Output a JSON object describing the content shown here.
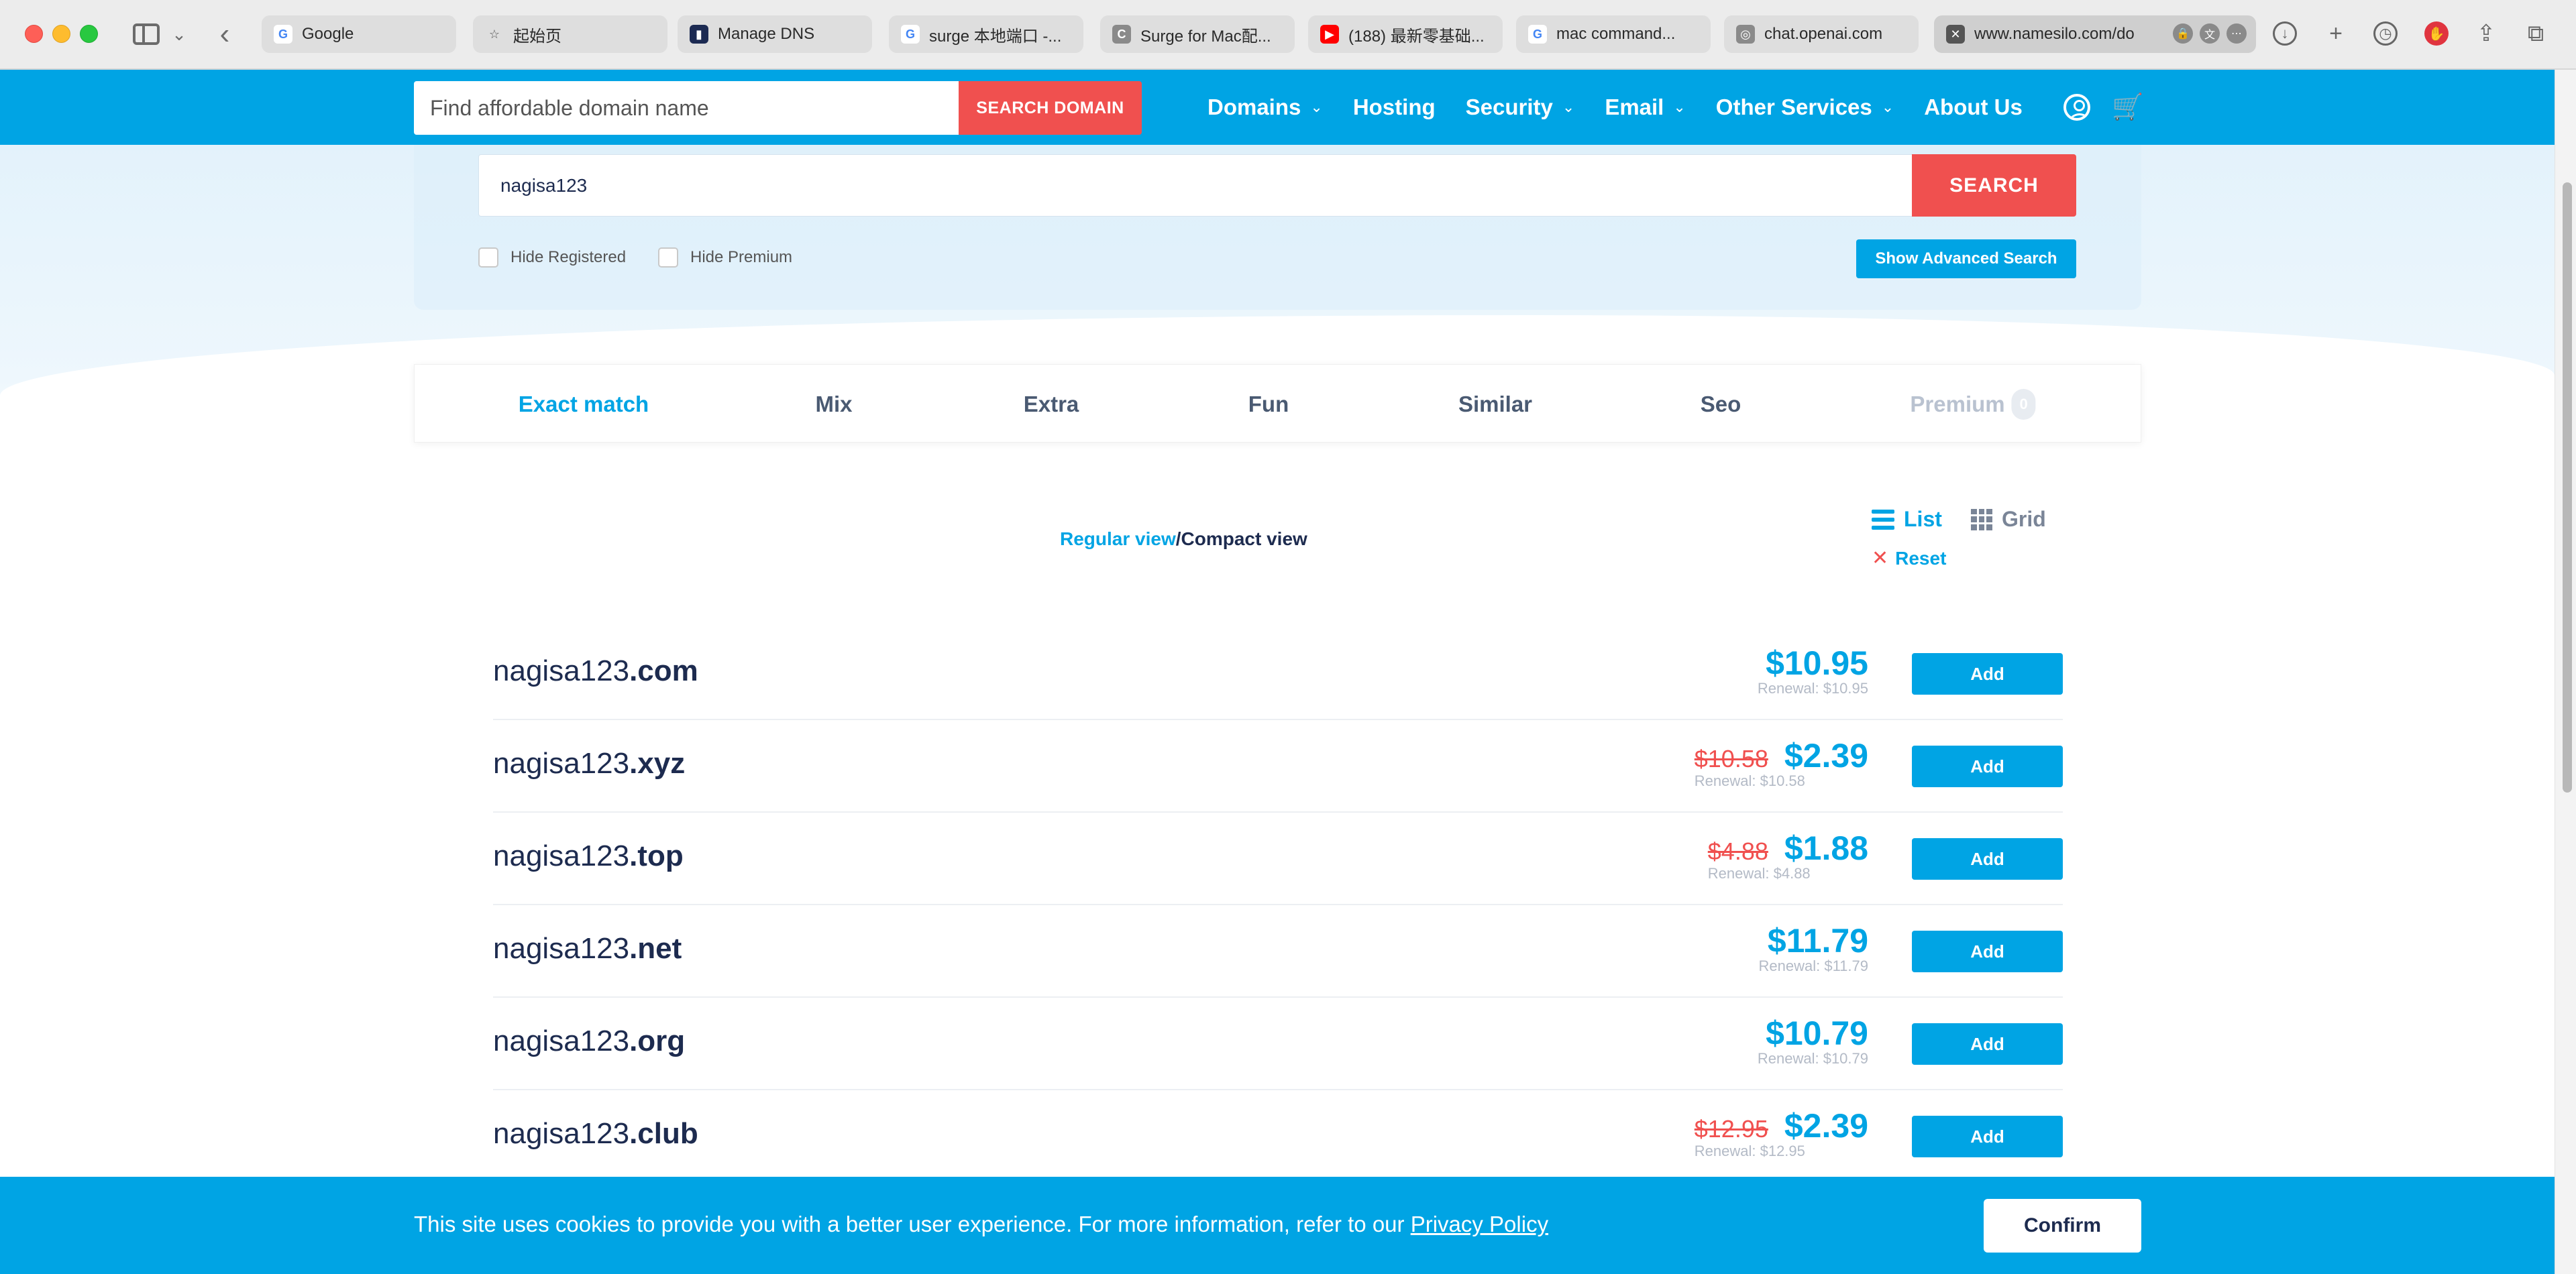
{
  "browser": {
    "tabs": [
      {
        "label": "Google",
        "favicon": "G",
        "favicon_color": "#4285f4",
        "favicon_bg": "#ffffff"
      },
      {
        "label": "起始页",
        "favicon": "☆",
        "favicon_color": "#555555",
        "favicon_bg": "transparent"
      },
      {
        "label": "Manage DNS",
        "favicon": "▮",
        "favicon_color": "#ffffff",
        "favicon_bg": "#1c2a52"
      },
      {
        "label": "surge 本地端口 -...",
        "favicon": "G",
        "favicon_color": "#4285f4",
        "favicon_bg": "#ffffff"
      },
      {
        "label": "Surge for Mac配...",
        "favicon": "C",
        "favicon_color": "#ffffff",
        "favicon_bg": "#8a8a8a"
      },
      {
        "label": "(188) 最新零基础...",
        "favicon": "▶",
        "favicon_color": "#ffffff",
        "favicon_bg": "#ff0000"
      },
      {
        "label": "mac command...",
        "favicon": "G",
        "favicon_color": "#4285f4",
        "favicon_bg": "#ffffff"
      },
      {
        "label": "chat.openai.com",
        "favicon": "◎",
        "favicon_color": "#ffffff",
        "favicon_bg": "#8a8a8a"
      },
      {
        "label": "www.namesilo.com/do",
        "favicon": "✕",
        "favicon_color": "#ffffff",
        "favicon_bg": "#555555"
      }
    ],
    "toolbar_icons": [
      "download-icon",
      "new-tab-icon",
      "history-icon",
      "extension-icon",
      "share-icon",
      "tabs-overview-icon"
    ]
  },
  "header": {
    "search_placeholder": "Find affordable domain name",
    "search_button": "SEARCH DOMAIN",
    "nav": [
      {
        "label": "Domains",
        "has_dropdown": true
      },
      {
        "label": "Hosting",
        "has_dropdown": false
      },
      {
        "label": "Security",
        "has_dropdown": true
      },
      {
        "label": "Email",
        "has_dropdown": true
      },
      {
        "label": "Other Services",
        "has_dropdown": true
      },
      {
        "label": "About Us",
        "has_dropdown": false
      }
    ],
    "brand_color": "#00a4e4",
    "accent_red": "#f0504f"
  },
  "search": {
    "query": "nagisa123",
    "button": "SEARCH",
    "hide_registered": "Hide Registered",
    "hide_premium": "Hide Premium",
    "advanced_button": "Show Advanced Search"
  },
  "category_tabs": [
    {
      "label": "Exact match",
      "active": true
    },
    {
      "label": "Mix"
    },
    {
      "label": "Extra"
    },
    {
      "label": "Fun"
    },
    {
      "label": "Similar"
    },
    {
      "label": "Seo"
    },
    {
      "label": "Premium",
      "count": "0",
      "muted": true
    }
  ],
  "view": {
    "regular": "Regular view",
    "separator": "/",
    "compact": "Compact view",
    "list": "List",
    "grid": "Grid",
    "reset": "Reset"
  },
  "results": [
    {
      "name": "nagisa123",
      "tld": ".com",
      "old_price": "",
      "price": "$10.95",
      "renewal": "Renewal: $10.95",
      "button": "Add"
    },
    {
      "name": "nagisa123",
      "tld": ".xyz",
      "old_price": "$10.58",
      "price": "$2.39",
      "renewal": "Renewal: $10.58",
      "button": "Add"
    },
    {
      "name": "nagisa123",
      "tld": ".top",
      "old_price": "$4.88",
      "price": "$1.88",
      "renewal": "Renewal: $4.88",
      "button": "Add"
    },
    {
      "name": "nagisa123",
      "tld": ".net",
      "old_price": "",
      "price": "$11.79",
      "renewal": "Renewal: $11.79",
      "button": "Add"
    },
    {
      "name": "nagisa123",
      "tld": ".org",
      "old_price": "",
      "price": "$10.79",
      "renewal": "Renewal: $10.79",
      "button": "Add"
    },
    {
      "name": "nagisa123",
      "tld": ".club",
      "old_price": "$12.95",
      "price": "$2.39",
      "renewal": "Renewal: $12.95",
      "button": "Add"
    }
  ],
  "cookie": {
    "text": "This site uses cookies to provide you with a better user experience. For more information, refer to our ",
    "link": "Privacy Policy",
    "button": "Confirm"
  }
}
